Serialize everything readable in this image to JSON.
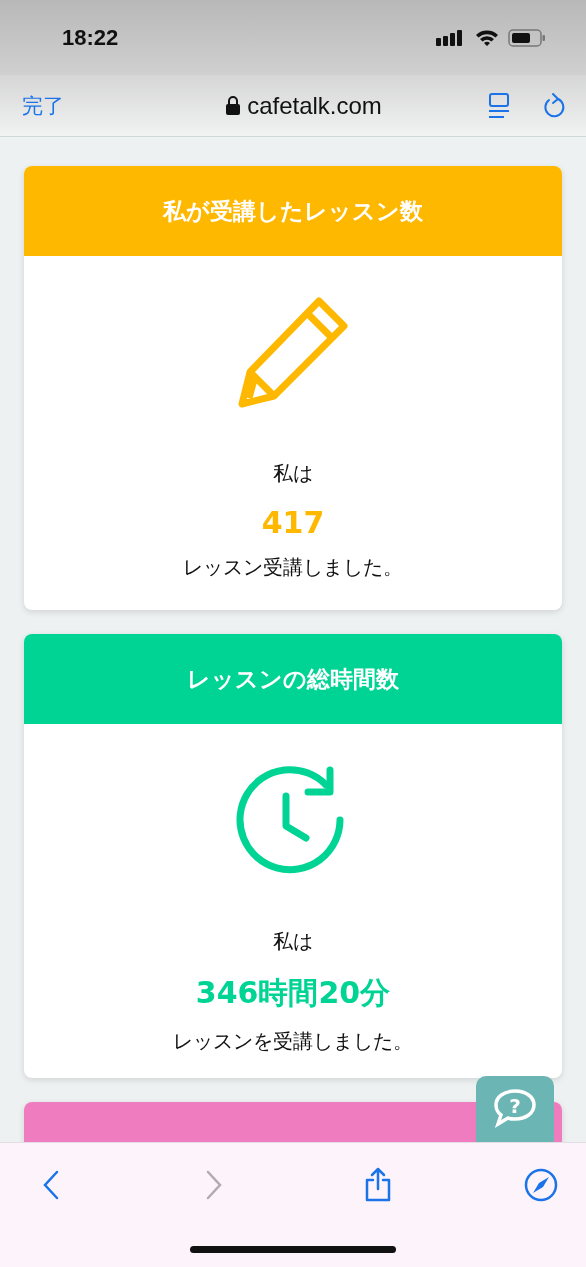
{
  "status_bar": {
    "time": "18:22"
  },
  "browser_bar": {
    "done": "完了",
    "url": "cafetalk.com"
  },
  "cards": [
    {
      "title": "私が受講したレッスン数",
      "color": "#ffb800",
      "kind": "pencil",
      "prefix": "私は",
      "value": "417",
      "suffix": "レッスン受講しました。"
    },
    {
      "title": "レッスンの総時間数",
      "color": "#00d494",
      "kind": "clock",
      "prefix": "私は",
      "value": "346時間20分",
      "suffix": "レッスンを受講しました。"
    },
    {
      "color": "#f07cc0"
    }
  ],
  "help_button": {
    "label": "?"
  },
  "toolbar": {
    "buttons": [
      {
        "kind": "back",
        "disabled": false
      },
      {
        "kind": "forward",
        "disabled": true
      },
      {
        "kind": "share",
        "disabled": false
      },
      {
        "kind": "compass",
        "disabled": false
      }
    ]
  }
}
